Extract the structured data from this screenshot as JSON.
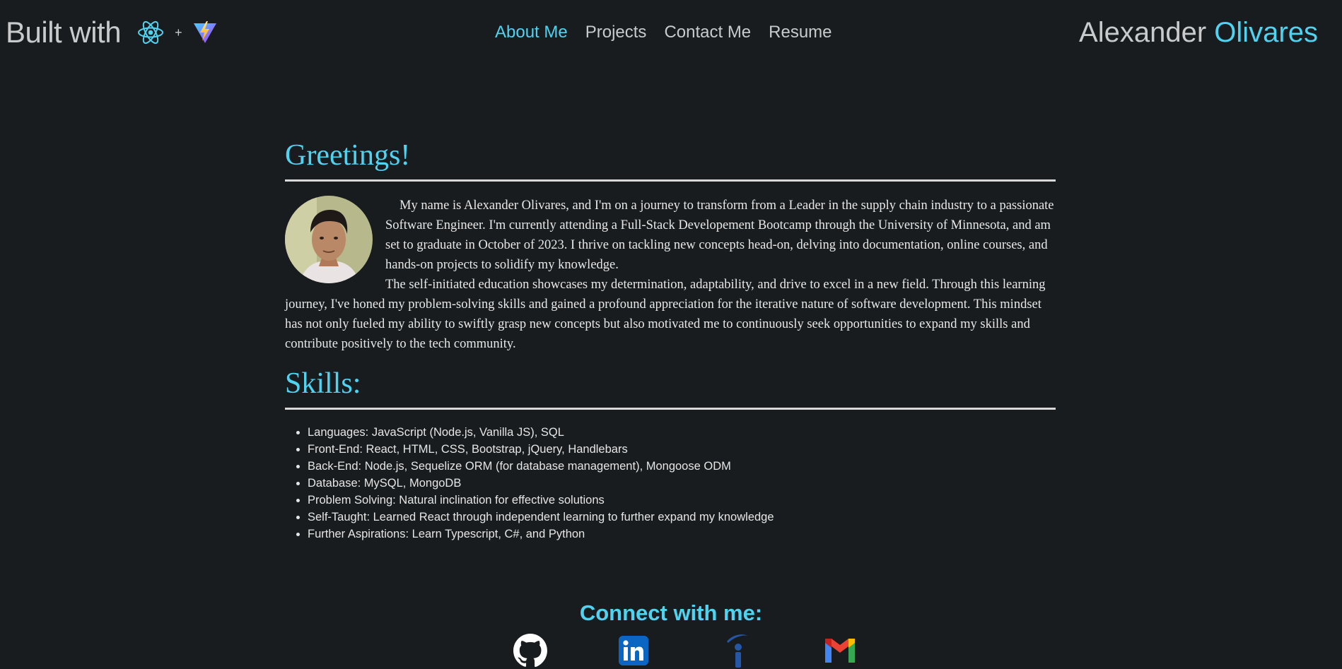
{
  "header": {
    "built_with": "Built with",
    "plus": "+",
    "nav": [
      "About Me",
      "Projects",
      "Contact Me",
      "Resume"
    ],
    "active_nav": "About Me",
    "name_first": "Alexander",
    "name_last": "Olivares"
  },
  "about": {
    "title": "Greetings!",
    "paragraph1": "My name is Alexander Olivares, and I'm on a journey to transform from a Leader in the supply chain industry to a passionate Software Engineer. I'm currently attending a Full-Stack Developement Bootcamp through the University of Minnesota, and am set to graduate in October of 2023. I thrive on tackling new concepts head-on, delving into documentation, online courses, and hands-on projects to solidify my knowledge.",
    "paragraph2": "The self-initiated education showcases my determination, adaptability, and drive to excel in a new field. Through this learning journey, I've honed my problem-solving skills and gained a profound appreciation for the iterative nature of software development. This mindset has not only fueled my ability to swiftly grasp new concepts but also motivated me to continuously seek opportunities to expand my skills and contribute positively to the tech community."
  },
  "skills": {
    "title": "Skills:",
    "items": [
      "Languages: JavaScript (Node.js, Vanilla JS), SQL",
      "Front-End: React, HTML, CSS, Bootstrap, jQuery, Handlebars",
      "Back-End: Node.js, Sequelize ORM (for database management), Mongoose ODM",
      "Database: MySQL, MongoDB",
      "Problem Solving: Natural inclination for effective solutions",
      "Self-Taught: Learned React through independent learning to further expand my knowledge",
      "Further Aspirations: Learn Typescript, C#, and Python"
    ]
  },
  "connect": {
    "title": "Connect with me:",
    "icons": [
      "github-icon",
      "linkedin-icon",
      "indeed-icon",
      "gmail-icon"
    ]
  },
  "colors": {
    "background": "#181c1f",
    "accent": "#4fd3f0",
    "text": "#c8cacb"
  }
}
